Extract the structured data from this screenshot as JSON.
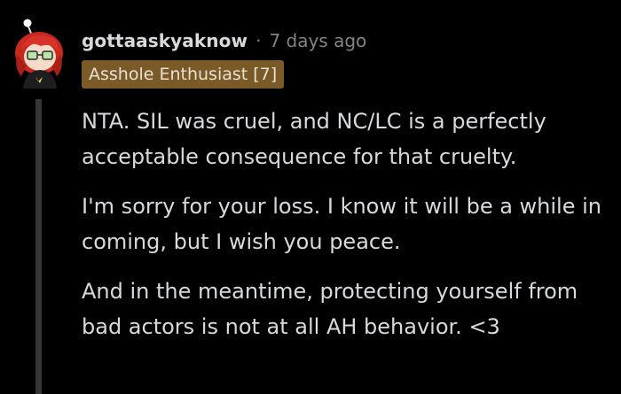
{
  "comment": {
    "username": "gottaaskyaknow",
    "separator": "·",
    "timestamp": "7 days ago",
    "flair": "Asshole Enthusiast [7]",
    "avatar_icon": "snoo-avatar-icon",
    "paragraphs": [
      "NTA. SIL was cruel, and NC/LC is a perfectly acceptable consequence for that cruelty.",
      "I'm sorry for your loss. I know it will be a while in coming, but I wish you peace.",
      "And in the meantime, protecting yourself from bad actors is not at all AH behavior. <3"
    ]
  },
  "colors": {
    "background": "#000000",
    "text": "#d7dadc",
    "meta": "#818384",
    "flair_bg": "#7a5a27",
    "thread_line": "#343536",
    "avatar_hair": "#c8281e"
  }
}
